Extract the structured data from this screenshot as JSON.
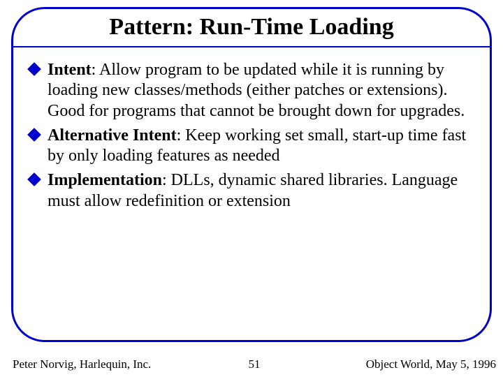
{
  "title": "Pattern: Run-Time Loading",
  "bullets": [
    {
      "label": "Intent",
      "text": ": Allow program to be updated while it is running by loading new classes/methods (either patches or extensions).  Good for programs that cannot be brought down for upgrades."
    },
    {
      "label": "Alternative Intent",
      "text": ": Keep working set small, start-up time fast by only loading features as needed"
    },
    {
      "label": "Implementation",
      "text": ": DLLs, dynamic shared libraries. Language must allow redefinition or extension"
    }
  ],
  "footer": {
    "left": "Peter Norvig, Harlequin, Inc.",
    "center": "51",
    "right": "Object World, May 5, 1996"
  }
}
